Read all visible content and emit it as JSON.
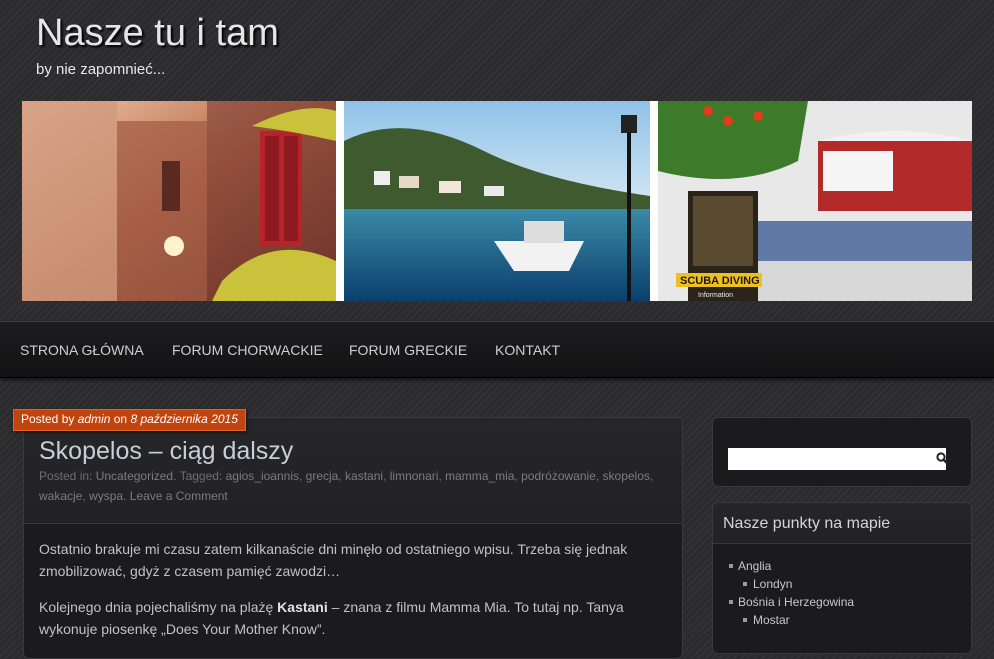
{
  "site": {
    "title": "Nasze tu i tam",
    "description": "by nie zapomnieć..."
  },
  "header_images": [
    {
      "icon": "croatian-alley-photo"
    },
    {
      "icon": "greek-harbour-photo",
      "sign": ""
    },
    {
      "icon": "greek-taverna-photo",
      "sign": "SCUBA DIVING",
      "sign2": "Information"
    }
  ],
  "nav": {
    "items": [
      {
        "label": "STRONA GŁÓWNA"
      },
      {
        "label": "FORUM CHORWACKIE"
      },
      {
        "label": "FORUM GRECKIE"
      },
      {
        "label": "KONTAKT"
      }
    ]
  },
  "post": {
    "posted_prefix": "Posted by",
    "author": "admin",
    "on_word": "on",
    "date": "8 października 2015",
    "title": "Skopelos – ciąg dalszy",
    "posted_in_label": "Posted in:",
    "category": "Uncategorized",
    "tagged_label": "Tagged:",
    "tags": [
      "agios_ioannis",
      "grecja",
      "kastani",
      "limnonari",
      "mamma_mia",
      "podróżowanie",
      "skopelos",
      "wakacje",
      "wyspa"
    ],
    "comment_link": "Leave a Comment",
    "paragraph1": "Ostatnio brakuje mi czasu zatem kilkanaście dni minęło od ostatniego wpisu. Trzeba się jednak zmobilizować, gdyż z czasem pamięć zawodzi…",
    "paragraph2_before": "Kolejnego dnia pojechaliśmy na plażę ",
    "paragraph2_bold": "Kastani",
    "paragraph2_after": " – znana z filmu Mamma Mia. To tutaj np. Tanya wykonuje piosenkę „Does Your Mother Know”."
  },
  "search": {
    "value": "",
    "placeholder": "",
    "icon": "search-icon"
  },
  "map_widget": {
    "title": "Nasze punkty na mapie",
    "items": [
      {
        "label": "Anglia",
        "level": 1
      },
      {
        "label": "Londyn",
        "level": 2
      },
      {
        "label": "Bośnia i Herzegowina",
        "level": 1
      },
      {
        "label": "Mostar",
        "level": 2
      }
    ]
  },
  "colors": {
    "accent_badge": "#c1440e",
    "background": "#2b2b2e",
    "post_title": "#c7cfd6"
  }
}
